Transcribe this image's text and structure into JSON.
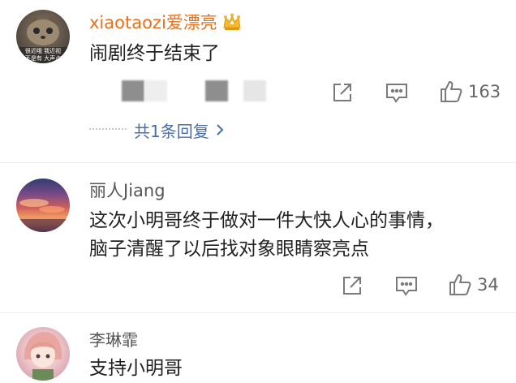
{
  "comments": [
    {
      "username": "xiaotaozi爱漂亮",
      "text": "闹剧终于结束了",
      "like_count": "163",
      "reply_summary": "共1条回复",
      "avatar_caption_line1": "很近哦 我近视",
      "avatar_caption_line2": "不是有 大声点"
    },
    {
      "username": "丽人Jiang",
      "text_line1": "这次小明哥终于做对一件大快人心的事情，",
      "text_line2": "脑子清醒了以后找对象眼睛察亮点",
      "like_count": "34"
    },
    {
      "username": "李琳霏",
      "text": "支持小明哥"
    }
  ],
  "colors": {
    "vip_name": "#e8701a",
    "link": "#4a6ea9",
    "icon": "#7a7a7a"
  },
  "icons": [
    "vip-crown-icon",
    "share-icon",
    "comment-icon",
    "like-icon",
    "chevron-right-icon"
  ]
}
